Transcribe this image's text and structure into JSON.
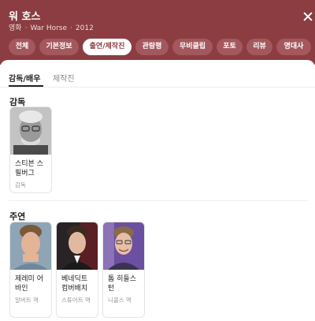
{
  "movie": {
    "title": "워 호스",
    "category": "영화",
    "original_title": "War Horse",
    "year": "2012"
  },
  "tabs": [
    "전체",
    "기본정보",
    "출연/제작진",
    "관람평",
    "무비클립",
    "포토",
    "리뷰",
    "명대사"
  ],
  "active_tab": "출연/제작진",
  "subtabs": {
    "cast_crew": "감독/배우",
    "production": "제작진"
  },
  "sections": {
    "director": {
      "title": "감독",
      "people": [
        {
          "name": "스티븐 스필버그",
          "role": "감독"
        }
      ]
    },
    "cast": {
      "title": "주연",
      "people": [
        {
          "name": "제레미 어바인",
          "role": "알버트 역"
        },
        {
          "name": "베네딕트 컴버배치",
          "role": "스튜어트 역"
        },
        {
          "name": "톰 히들스턴",
          "role": "니콜스 역"
        }
      ]
    }
  },
  "colors": {
    "header_bg": "#8b3d41",
    "tab_bg": "#a4585d",
    "active_tab_text": "#8b3d41"
  }
}
